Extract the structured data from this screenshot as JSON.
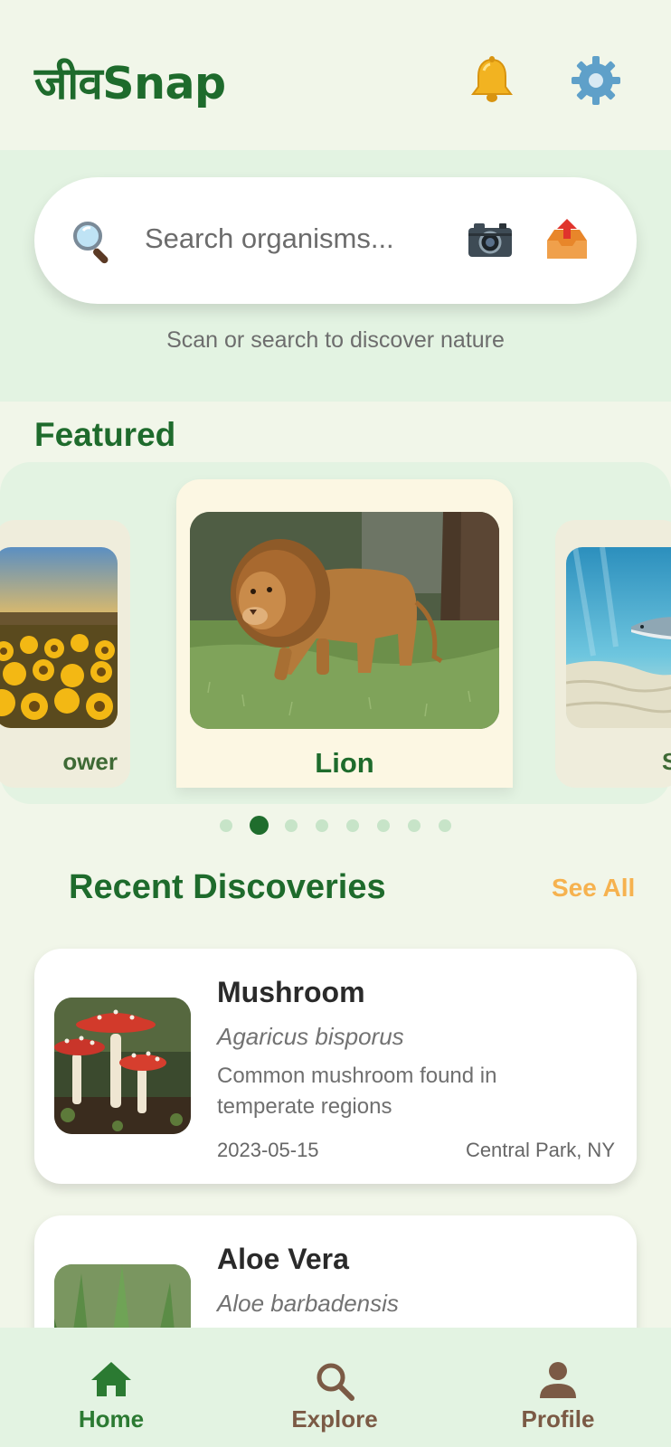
{
  "header": {
    "app_title": "जीवSnap",
    "notification_icon": "bell-icon",
    "settings_icon": "gear-icon"
  },
  "search": {
    "placeholder": "Search organisms...",
    "hint": "Scan or search to discover nature",
    "camera_icon": "camera-icon",
    "upload_icon": "upload-tray-icon"
  },
  "featured": {
    "title": "Featured",
    "cards": [
      {
        "label": "Sunflower",
        "visible_label": "ower"
      },
      {
        "label": "Lion"
      },
      {
        "label": "Shark",
        "visible_label": "S"
      }
    ],
    "active_index": 1,
    "dot_count": 8
  },
  "recent": {
    "title": "Recent Discoveries",
    "see_all": "See All",
    "items": [
      {
        "name": "Mushroom",
        "scientific": "Agaricus bisporus",
        "description": "Common mushroom found in temperate regions",
        "date": "2023-05-15",
        "location": "Central Park, NY"
      },
      {
        "name": "Aloe Vera",
        "scientific": "Aloe barbadensis"
      }
    ]
  },
  "nav": {
    "items": [
      {
        "label": "Home",
        "icon": "home-icon",
        "active": true
      },
      {
        "label": "Explore",
        "icon": "search-icon",
        "active": false
      },
      {
        "label": "Profile",
        "icon": "user-icon",
        "active": false
      }
    ]
  },
  "colors": {
    "background": "#f1f6e9",
    "primary_green": "#1e6b2c",
    "accent_orange": "#f6b24f",
    "nav_inactive": "#7b5a45"
  }
}
